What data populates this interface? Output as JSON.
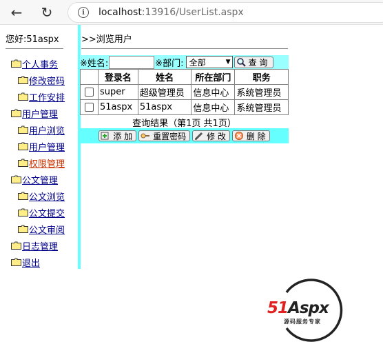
{
  "browser": {
    "url_host": "localhost",
    "url_rest": ":13916/UserList.aspx"
  },
  "sidebar": {
    "greeting": "您好:51aspx",
    "items": [
      {
        "label": "个人事务"
      },
      {
        "label": "修改密码"
      },
      {
        "label": "工作安排"
      },
      {
        "label": "用户管理"
      },
      {
        "label": "用户浏览"
      },
      {
        "label": "用户管理"
      },
      {
        "label": "权限管理"
      },
      {
        "label": "公文管理"
      },
      {
        "label": "公文浏览"
      },
      {
        "label": "公文提交"
      },
      {
        "label": "公文审阅"
      },
      {
        "label": "日志管理"
      },
      {
        "label": "退出"
      }
    ]
  },
  "main": {
    "breadcrumb": ">>浏览用户",
    "search": {
      "name_label": "※姓名:",
      "name_value": "",
      "dept_label": "※部门:",
      "dept_selected": "全部",
      "query_button": "查 询"
    },
    "table": {
      "headers": [
        "登录名",
        "姓名",
        "所在部门",
        "职务"
      ],
      "rows": [
        [
          "super",
          "超级管理员",
          "信息中心",
          "系统管理员"
        ],
        [
          "51aspx",
          "51aspx",
          "信息中心",
          "系统管理员"
        ]
      ]
    },
    "result_text": "查询结果（第1页 共1页）",
    "actions": {
      "add": "添 加",
      "reset_password": "重置密码",
      "edit": "修 改",
      "delete": "删 除"
    }
  },
  "logo": {
    "text_51": "51",
    "text_aspx": "Aspx",
    "subtitle": "源码服务专家"
  },
  "colors": {
    "splitter": "#66ffff",
    "search_bar": "#99ffff",
    "link": "#00008b",
    "link_active": "#cc3300",
    "logo_red": "#e02020",
    "logo_green": "#2e9e2e"
  }
}
